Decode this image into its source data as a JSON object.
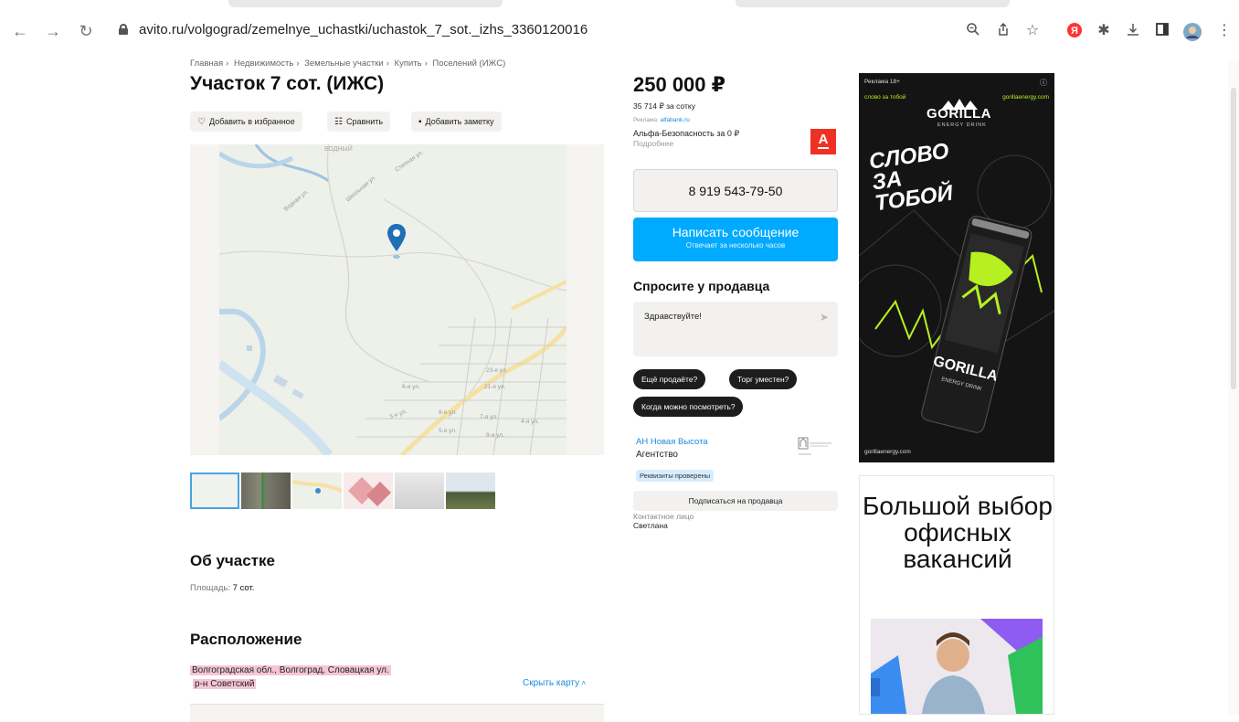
{
  "browser": {
    "url": "avito.ru/volgograd/zemelnye_uchastki/uchastok_7_sot._izhs_3360120016",
    "icons": [
      "back-icon",
      "forward-icon",
      "reload-icon",
      "zoom-icon",
      "share-icon",
      "star-icon",
      "yandex-icon",
      "extensions-icon",
      "download-icon",
      "sidepanel-icon",
      "avatar",
      "menu-icon"
    ]
  },
  "breadcrumbs": [
    "Главная",
    "Недвижимость",
    "Земельные участки",
    "Купить",
    "Поселений (ИЖС)"
  ],
  "title": "Участок 7 сот. (ИЖС)",
  "actions": {
    "favorite": "Добавить в избранное",
    "compare": "Сравнить",
    "note": "Добавить заметку"
  },
  "map_labels": [
    "ВОДНЫЙ",
    "Водная ул.",
    "Школьная ул.",
    "Степная ул.",
    "6-я ул.",
    "21-я ул.",
    "23-я ул.",
    "3-я ул.",
    "8-я ул.",
    "7-я ул.",
    "9-я ул.",
    "5-я ул.",
    "4-я ул."
  ],
  "about": {
    "heading": "Об участке",
    "area_label": "Площадь:",
    "area_value": "7 сот."
  },
  "location": {
    "heading": "Расположение",
    "address_line1": "Волгоградская обл., Волгоград, Словацкая ул.",
    "address_line2": "р-н Советский",
    "hide_map": "Скрыть карту"
  },
  "price": {
    "value": "250 000 ₽",
    "per_sotka": "35 714 ₽ за сотку"
  },
  "promo": {
    "label": "Реклама",
    "site": "alfabank.ru",
    "title": "Альфа-Безопасность за 0 ₽",
    "more": "Подробнее",
    "logo_letter": "А"
  },
  "contact": {
    "phone": "8 919 543-79-50",
    "write": "Написать сообщение",
    "write_sub": "Отвечает за несколько часов",
    "ask_heading": "Спросите у продавца",
    "ask_value": "Здравствуйте!",
    "chips": [
      "Ещё продаёте?",
      "Торг уместен?",
      "Когда можно посмотреть?"
    ]
  },
  "seller": {
    "name": "АН Новая Высота",
    "type": "Агентство",
    "badge": "Реквизиты проверены",
    "subscribe": "Подписаться на продавца",
    "contact_label": "Контактное лицо",
    "contact_name": "Светлана"
  },
  "ad_gorilla": {
    "tag": "Реклама   18+",
    "slogan_small": "слово за тобой",
    "site": "gorillaenergy.com",
    "brand": "GORILLA",
    "brand_sub": "ENERGY DRINK",
    "big_slogan": "СЛОВО ЗА ТОБОЙ",
    "footer": "gorillaenergy.com",
    "accent": "#b7f020"
  },
  "ad_jobs": {
    "text": "Большой выбор офисных вакансий"
  }
}
